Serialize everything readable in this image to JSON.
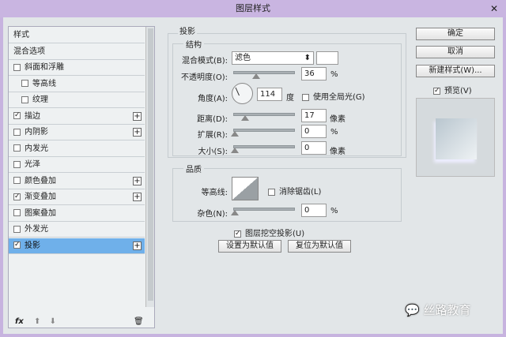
{
  "title": "图层样式",
  "sidebar": {
    "items": [
      {
        "label": "样式",
        "check": false,
        "hasCheck": false
      },
      {
        "label": "混合选项",
        "hasCheck": false
      },
      {
        "label": "斜面和浮雕",
        "check": false,
        "hasCheck": true
      },
      {
        "label": "等高线",
        "check": false,
        "hasCheck": true,
        "indent": true
      },
      {
        "label": "纹理",
        "check": false,
        "hasCheck": true,
        "indent": true
      },
      {
        "label": "描边",
        "check": true,
        "hasCheck": true,
        "plus": true
      },
      {
        "label": "内阴影",
        "check": false,
        "hasCheck": true,
        "plus": true
      },
      {
        "label": "内发光",
        "check": false,
        "hasCheck": true
      },
      {
        "label": "光泽",
        "check": false,
        "hasCheck": true
      },
      {
        "label": "颜色叠加",
        "check": false,
        "hasCheck": true,
        "plus": true
      },
      {
        "label": "渐变叠加",
        "check": true,
        "hasCheck": true,
        "plus": true
      },
      {
        "label": "图案叠加",
        "check": false,
        "hasCheck": true
      },
      {
        "label": "外发光",
        "check": false,
        "hasCheck": true
      },
      {
        "label": "投影",
        "check": true,
        "hasCheck": true,
        "plus": true,
        "selected": true
      }
    ],
    "fx": "fx"
  },
  "panel": {
    "heading": "投影",
    "structure": "结构",
    "blend_label": "混合模式(B):",
    "blend_value": "滤色",
    "opacity_label": "不透明度(O):",
    "opacity": "36",
    "opacity_unit": "%",
    "angle_label": "角度(A):",
    "angle": "114",
    "angle_unit": "度",
    "global_light": "使用全局光(G)",
    "distance_label": "距离(D):",
    "distance": "17",
    "distance_unit": "像素",
    "spread_label": "扩展(R):",
    "spread": "0",
    "spread_unit": "%",
    "size_label": "大小(S):",
    "size": "0",
    "size_unit": "像素",
    "quality": "品质",
    "contour_label": "等高线:",
    "antialias": "消除锯齿(L)",
    "noise_label": "杂色(N):",
    "noise": "0",
    "noise_unit": "%",
    "knockout": "图层挖空投影(U)",
    "set_default": "设置为默认值",
    "reset_default": "复位为默认值"
  },
  "buttons": {
    "ok": "确定",
    "cancel": "取消",
    "new_style": "新建样式(W)...",
    "preview": "预览(V)"
  },
  "watermark": "丝路教育"
}
